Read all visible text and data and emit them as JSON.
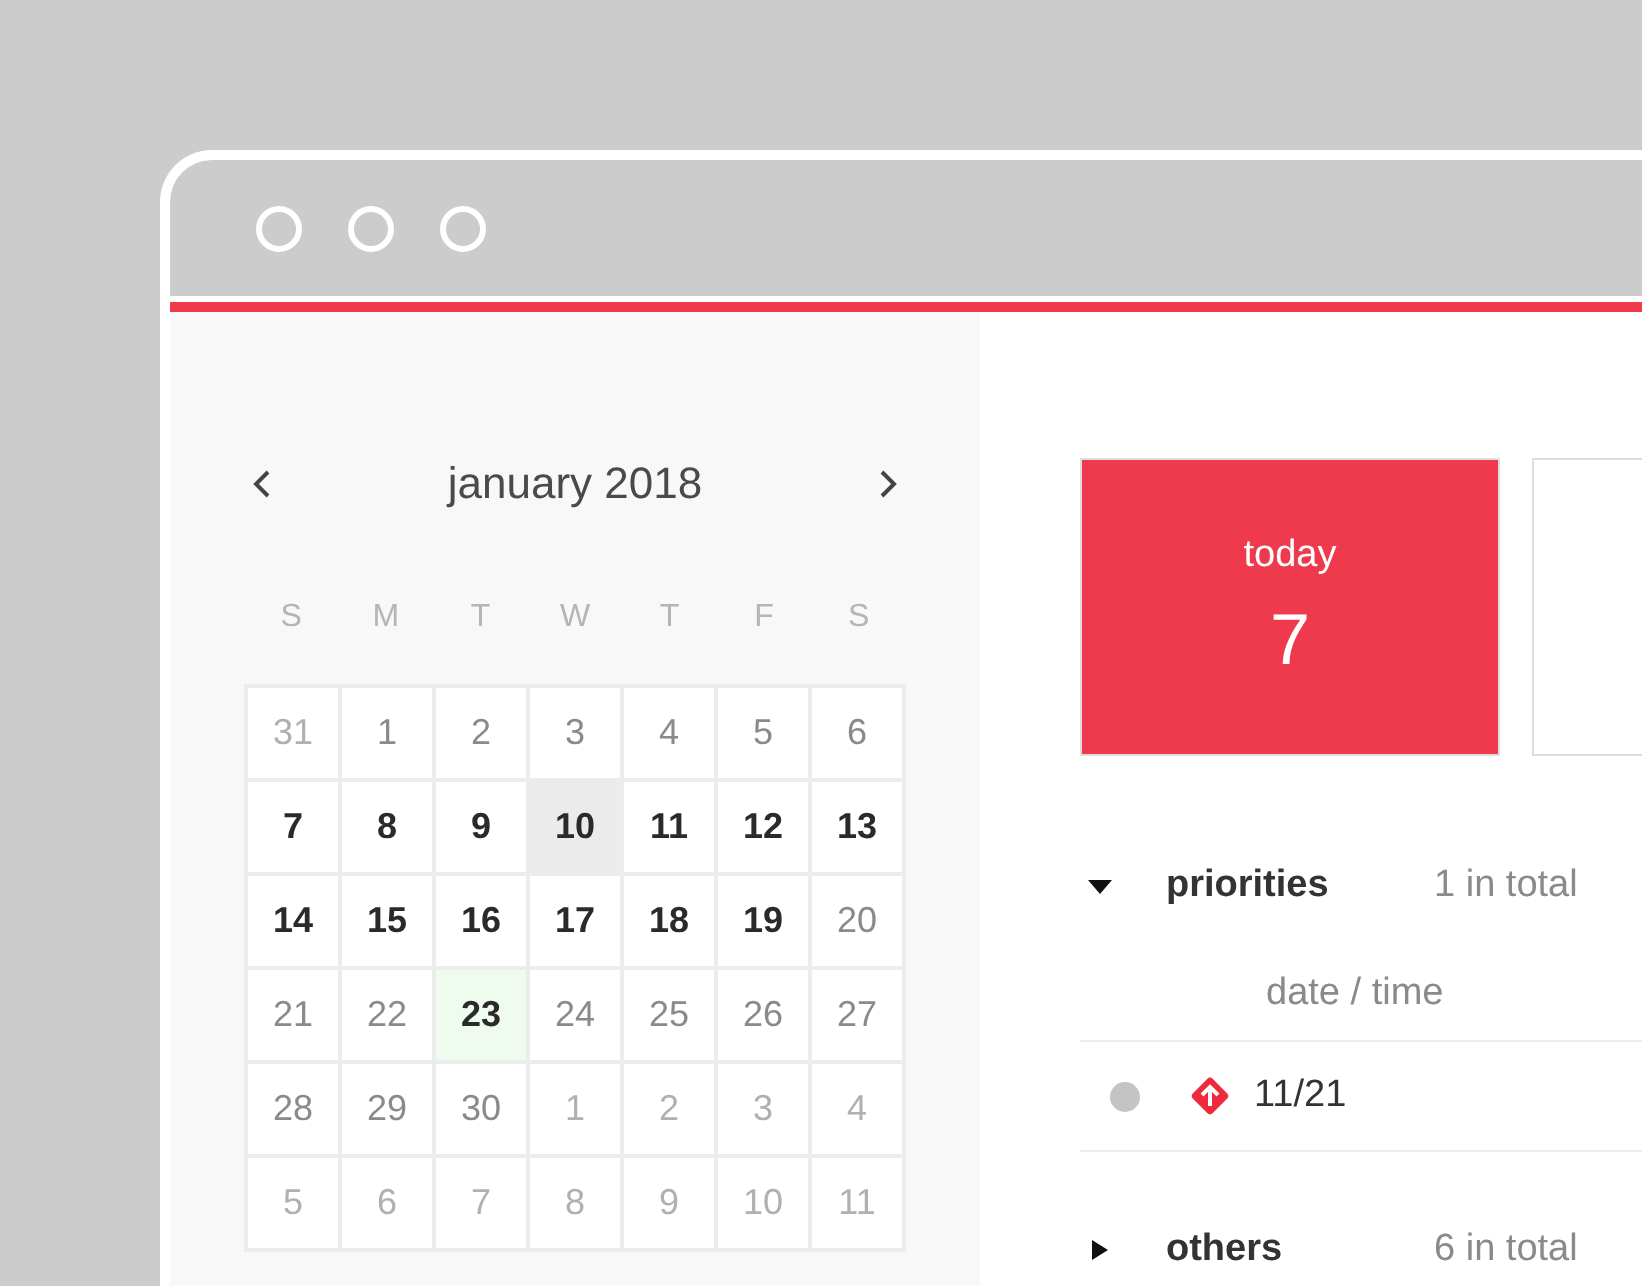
{
  "calendar": {
    "title": "january 2018",
    "weekdays": [
      "S",
      "M",
      "T",
      "W",
      "T",
      "F",
      "S"
    ],
    "days": [
      {
        "label": "31",
        "kind": "outside",
        "selected": false,
        "hovered": false
      },
      {
        "label": "1",
        "kind": "plain",
        "selected": false,
        "hovered": false
      },
      {
        "label": "2",
        "kind": "plain",
        "selected": false,
        "hovered": false
      },
      {
        "label": "3",
        "kind": "plain",
        "selected": false,
        "hovered": false
      },
      {
        "label": "4",
        "kind": "plain",
        "selected": false,
        "hovered": false
      },
      {
        "label": "5",
        "kind": "plain",
        "selected": false,
        "hovered": false
      },
      {
        "label": "6",
        "kind": "plain",
        "selected": false,
        "hovered": false
      },
      {
        "label": "7",
        "kind": "strong",
        "selected": false,
        "hovered": false
      },
      {
        "label": "8",
        "kind": "strong",
        "selected": false,
        "hovered": false
      },
      {
        "label": "9",
        "kind": "strong",
        "selected": false,
        "hovered": false
      },
      {
        "label": "10",
        "kind": "strong",
        "selected": false,
        "hovered": true
      },
      {
        "label": "11",
        "kind": "strong",
        "selected": false,
        "hovered": false
      },
      {
        "label": "12",
        "kind": "strong",
        "selected": false,
        "hovered": false
      },
      {
        "label": "13",
        "kind": "strong",
        "selected": false,
        "hovered": false
      },
      {
        "label": "14",
        "kind": "strong",
        "selected": false,
        "hovered": false
      },
      {
        "label": "15",
        "kind": "strong",
        "selected": false,
        "hovered": false
      },
      {
        "label": "16",
        "kind": "strong",
        "selected": false,
        "hovered": false
      },
      {
        "label": "17",
        "kind": "strong",
        "selected": false,
        "hovered": false
      },
      {
        "label": "18",
        "kind": "strong",
        "selected": false,
        "hovered": false
      },
      {
        "label": "19",
        "kind": "strong",
        "selected": false,
        "hovered": false
      },
      {
        "label": "20",
        "kind": "plain",
        "selected": false,
        "hovered": false
      },
      {
        "label": "21",
        "kind": "plain",
        "selected": false,
        "hovered": false
      },
      {
        "label": "22",
        "kind": "plain",
        "selected": false,
        "hovered": false
      },
      {
        "label": "23",
        "kind": "strong",
        "selected": true,
        "hovered": false
      },
      {
        "label": "24",
        "kind": "plain",
        "selected": false,
        "hovered": false
      },
      {
        "label": "25",
        "kind": "plain",
        "selected": false,
        "hovered": false
      },
      {
        "label": "26",
        "kind": "plain",
        "selected": false,
        "hovered": false
      },
      {
        "label": "27",
        "kind": "plain",
        "selected": false,
        "hovered": false
      },
      {
        "label": "28",
        "kind": "plain",
        "selected": false,
        "hovered": false
      },
      {
        "label": "29",
        "kind": "plain",
        "selected": false,
        "hovered": false
      },
      {
        "label": "30",
        "kind": "plain",
        "selected": false,
        "hovered": false
      },
      {
        "label": "1",
        "kind": "outside",
        "selected": false,
        "hovered": false
      },
      {
        "label": "2",
        "kind": "outside",
        "selected": false,
        "hovered": false
      },
      {
        "label": "3",
        "kind": "outside",
        "selected": false,
        "hovered": false
      },
      {
        "label": "4",
        "kind": "outside",
        "selected": false,
        "hovered": false
      },
      {
        "label": "5",
        "kind": "outside",
        "selected": false,
        "hovered": false
      },
      {
        "label": "6",
        "kind": "outside",
        "selected": false,
        "hovered": false
      },
      {
        "label": "7",
        "kind": "outside",
        "selected": false,
        "hovered": false
      },
      {
        "label": "8",
        "kind": "outside",
        "selected": false,
        "hovered": false
      },
      {
        "label": "9",
        "kind": "outside",
        "selected": false,
        "hovered": false
      },
      {
        "label": "10",
        "kind": "outside",
        "selected": false,
        "hovered": false
      },
      {
        "label": "11",
        "kind": "outside",
        "selected": false,
        "hovered": false
      }
    ]
  },
  "summary_cards": [
    {
      "label": "today",
      "value": "7",
      "selected": true
    },
    {
      "selected": false
    }
  ],
  "sections": [
    {
      "title": "priorities",
      "count": "1 in total",
      "expanded": true,
      "column_header": "date / time",
      "rows": [
        {
          "date": "11/21",
          "color": "#c4c4c4"
        }
      ]
    },
    {
      "title": "others",
      "count": "6 in total",
      "expanded": false
    }
  ]
}
